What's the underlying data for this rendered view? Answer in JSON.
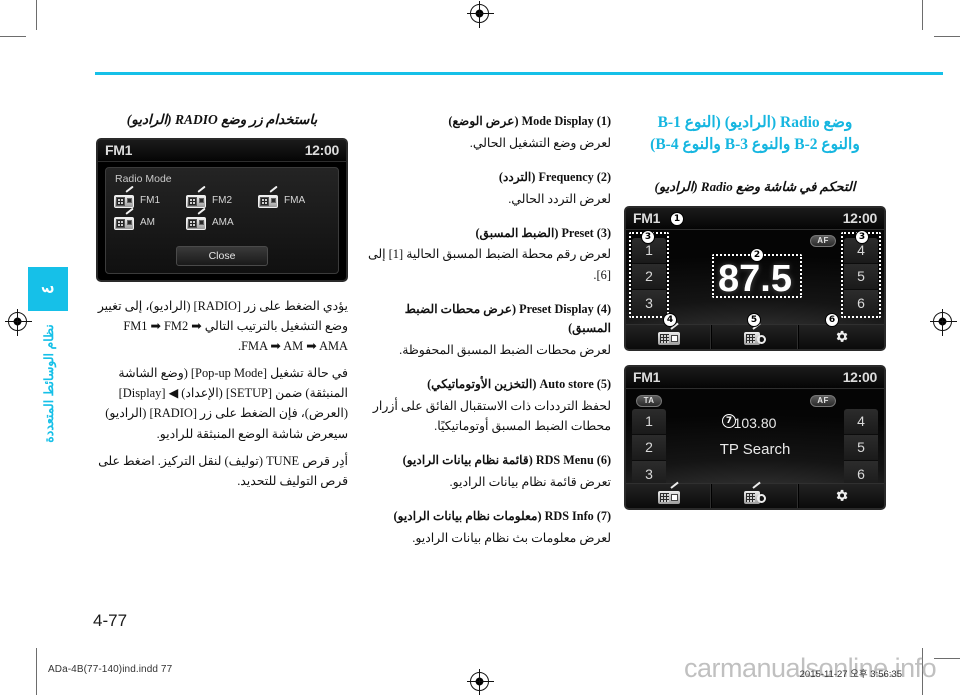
{
  "page": {
    "number": "4-77",
    "footer_file": "ADa-4B(77-140)ind.indd   77",
    "footer_timestamp": "2015-11-27   오후 3:56:35",
    "watermark": "carmanualsonline.info",
    "accent_color": "#16c0e8"
  },
  "side_tab": {
    "chapter_number": "٤",
    "chapter_label": "نظام الوسائط المتعددة"
  },
  "left_column": {
    "heading": "باستخدام زر وضع RADIO (الراديو)",
    "screen": {
      "source": "FM1",
      "clock": "12:00",
      "popup_title": "Radio Mode",
      "modes": [
        "FM1",
        "FM2",
        "FMA",
        "AM",
        "AMA"
      ],
      "close_label": "Close"
    },
    "paragraphs": [
      "يؤدي الضغط على زر [RADIO] (الراديو)، إلى تغيير وضع التشغيل بالترتيب التالي FM1 ➡ FM2 ➡ FMA ➡ AM ➡ AMA.",
      "في حالة تشغيل [Pop-up Mode] (وضع الشاشة المنبثقة) ضمن [SETUP] (الإعداد) ◀ [Display] (العرض)، فإن الضغط على زر [RADIO] (الراديو) سيعرض شاشة الوضع المنبثقة للراديو.",
      "أدِر قرص TUNE (توليف) لنقل التركيز. اضغط على قرص التوليف للتحديد."
    ]
  },
  "middle_column": {
    "items": [
      {
        "title": "(1) Mode Display (عرض الوضع)",
        "desc": "لعرض وضع التشغيل الحالي."
      },
      {
        "title": "(2) Frequency (التردد)",
        "desc": "لعرض التردد الحالي."
      },
      {
        "title": "(3) Preset (الضبط المسبق)",
        "desc": "لعرض رقم محطة الضبط المسبق الحالية [1] إلى [6]."
      },
      {
        "title": "(4) Preset Display (عرض محطات الضبط المسبق)",
        "desc": "لعرض محطات الضبط المسبق المحفوظة."
      },
      {
        "title": "(5) Auto store (التخزين الأوتوماتيكي)",
        "desc": "لحفظ الترددات ذات الاستقبال الفائق على أزرار محطات الضبط المسبق أوتوماتيكيًا."
      },
      {
        "title": "(6) RDS Menu (قائمة نظام بيانات الراديو)",
        "desc": "تعرض قائمة نظام بيانات الراديو."
      },
      {
        "title": "(7) RDS Info (معلومات نظام بيانات الراديو)",
        "desc": "لعرض معلومات بث نظام بيانات الراديو."
      }
    ]
  },
  "right_column": {
    "heading_line1": "وضع Radio (الراديو) (النوع B-1",
    "heading_line2": "والنوع B-2 والنوع B-3 والنوع B-4)",
    "subheading": "التحكم في شاشة وضع Radio (الراديو)",
    "screen_top": {
      "source": "FM1",
      "clock": "12:00",
      "af_badge": "AF",
      "frequency": "87.5",
      "presets_left": [
        "1",
        "2",
        "3"
      ],
      "presets_right": [
        "4",
        "5",
        "6"
      ],
      "callouts": [
        "1",
        "2",
        "3",
        "3",
        "4",
        "5",
        "6"
      ]
    },
    "screen_bottom": {
      "source": "FM1",
      "clock": "12:00",
      "ta_badge": "TA",
      "af_badge": "AF",
      "frequency": "103.80",
      "status_text": "TP Search",
      "presets_left": [
        "1",
        "2",
        "3"
      ],
      "presets_right": [
        "4",
        "5",
        "6"
      ],
      "callout": "7"
    },
    "soft_icons": [
      "radio-list-icon",
      "radio-search-icon",
      "gear-icon"
    ]
  }
}
